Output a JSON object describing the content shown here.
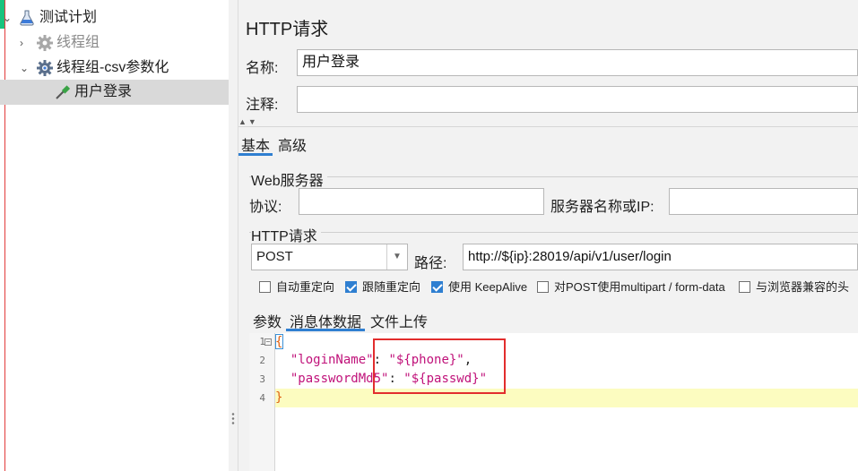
{
  "tree": {
    "items": [
      {
        "label": "测试计划"
      },
      {
        "label": "线程组"
      },
      {
        "label": "线程组-csv参数化"
      },
      {
        "label": "用户登录"
      }
    ]
  },
  "sampler": {
    "title": "HTTP请求",
    "name_label": "名称:",
    "name_value": "用户登录",
    "comment_label": "注释:",
    "comment_value": ""
  },
  "tabs": {
    "basic": "基本",
    "advanced": "高级"
  },
  "web_server": {
    "group_title": "Web服务器",
    "protocol_label": "协议:",
    "protocol_value": "",
    "server_label": "服务器名称或IP:",
    "server_value": ""
  },
  "http_request": {
    "group_title": "HTTP请求",
    "method": "POST",
    "path_label": "路径:",
    "path_value": "http://${ip}:28019/api/v1/user/login"
  },
  "options": [
    {
      "label": "自动重定向",
      "checked": false
    },
    {
      "label": "跟随重定向",
      "checked": true
    },
    {
      "label": "使用 KeepAlive",
      "checked": true
    },
    {
      "label": "对POST使用multipart / form-data",
      "checked": false
    },
    {
      "label": "与浏览器兼容的头",
      "checked": false
    }
  ],
  "body_tabs": {
    "params": "参数",
    "body": "消息体数据",
    "files": "文件上传"
  },
  "editor": {
    "line_numbers": [
      "1",
      "2",
      "3",
      "4"
    ],
    "open_brace": "{",
    "key1": "\"loginName\"",
    "value1": "\"${phone}\"",
    "key2": "\"passwordMd5\"",
    "value2": "\"${passwd}\"",
    "close_brace": "}"
  },
  "colors": {
    "accent": "#2f7fd1",
    "highlight": "#e22d2d",
    "string": "#c0127a"
  }
}
